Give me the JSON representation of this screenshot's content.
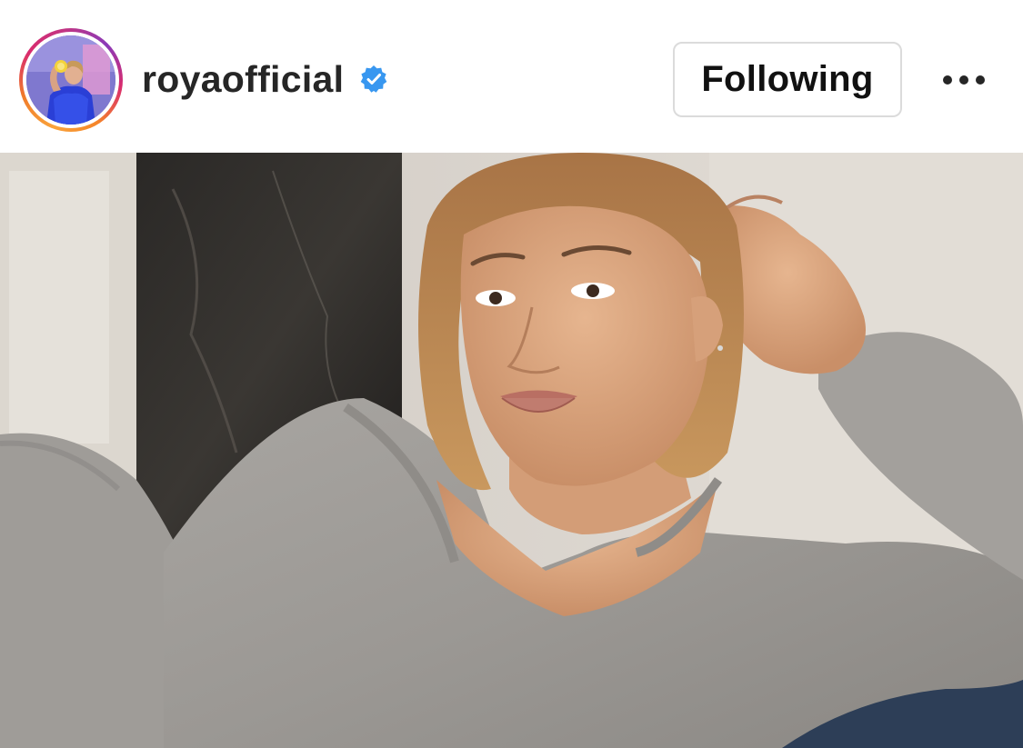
{
  "post": {
    "header": {
      "username": "royaofficial",
      "verified": true,
      "follow_button_label": "Following",
      "more_icon": "more-horizontal-icon"
    },
    "colors": {
      "verified_badge": "#3897f0",
      "username_text": "#262626",
      "button_border": "#dbdbdb",
      "story_ring_start": "#f9a33b",
      "story_ring_end": "#c13584"
    },
    "media": {
      "type": "photo",
      "description_icon": "post-photo"
    }
  }
}
